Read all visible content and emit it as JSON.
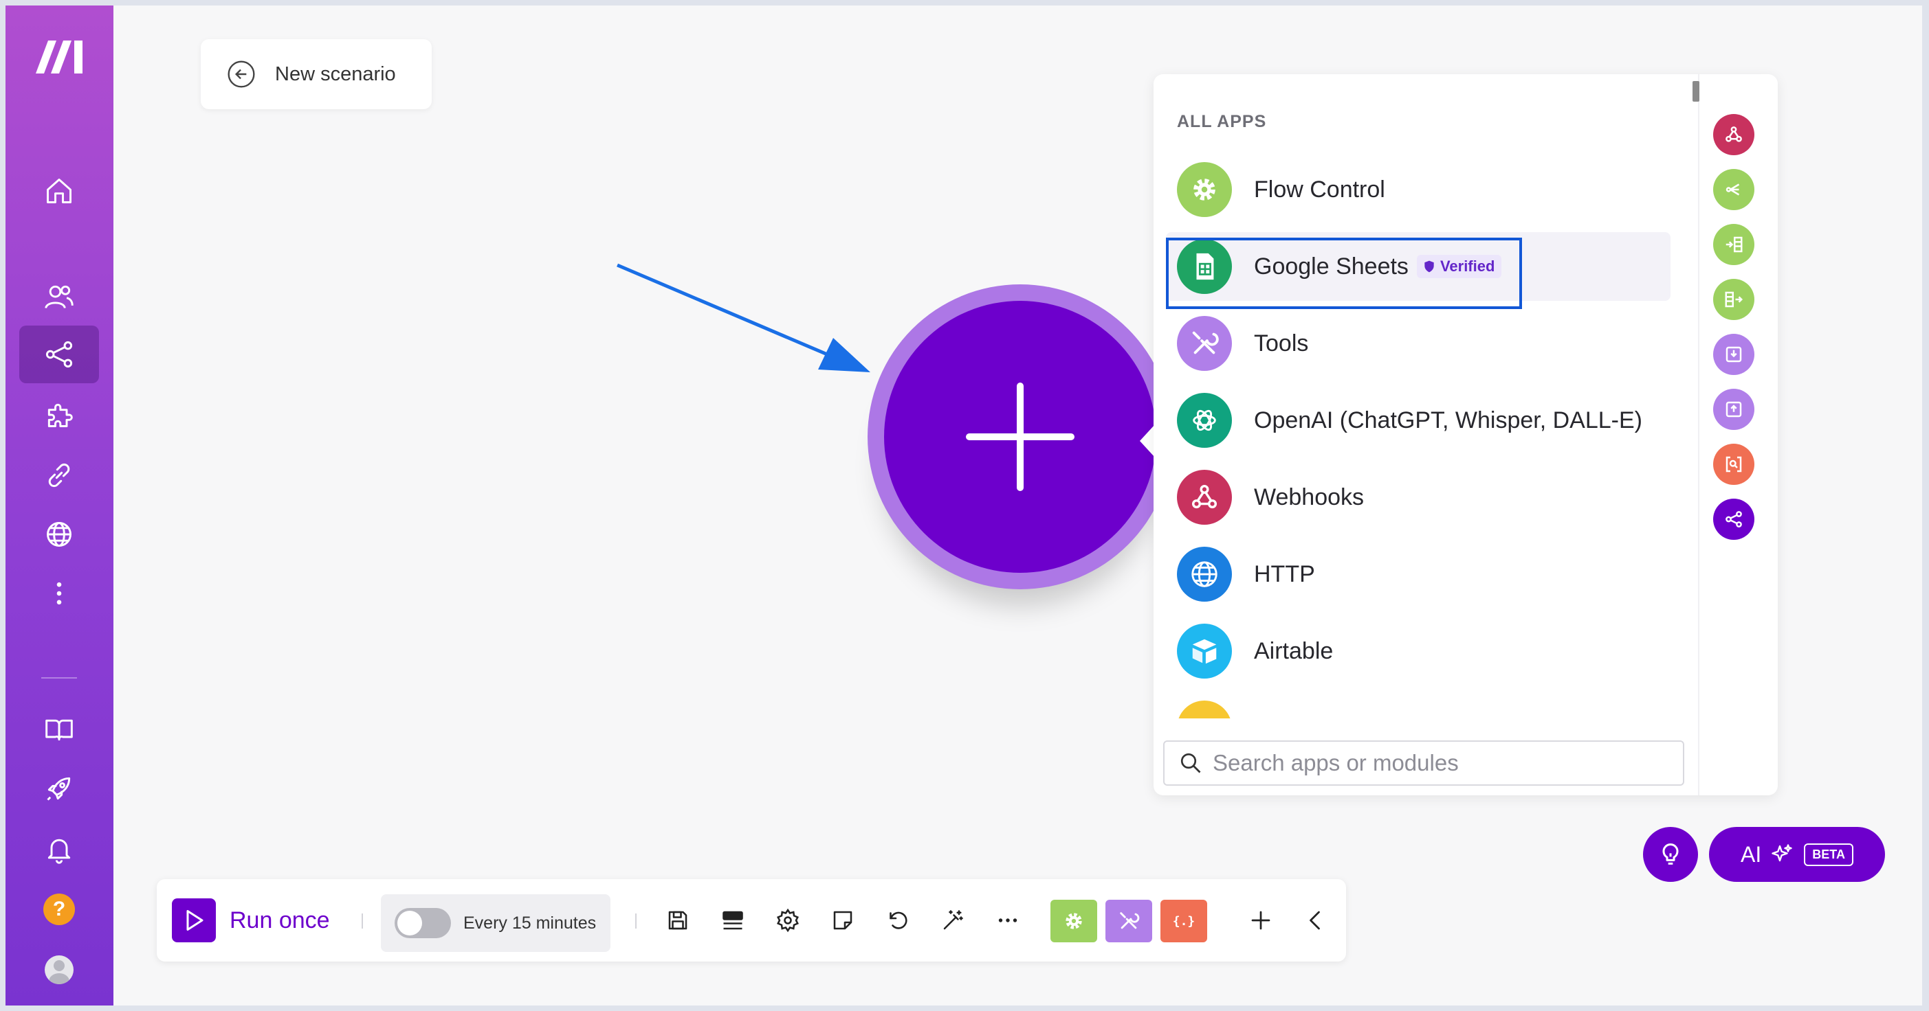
{
  "header": {
    "title": "New scenario"
  },
  "sidebar": {
    "items": [
      {
        "id": "home",
        "icon": "home-icon"
      },
      {
        "id": "team",
        "icon": "users-icon"
      },
      {
        "id": "scenarios",
        "icon": "share-nodes-icon",
        "active": true
      },
      {
        "id": "apps",
        "icon": "puzzle-icon"
      },
      {
        "id": "connections",
        "icon": "link-icon"
      },
      {
        "id": "webhooks",
        "icon": "globe-icon"
      },
      {
        "id": "more",
        "icon": "more-vertical-icon"
      },
      {
        "id": "docs",
        "icon": "book-icon"
      },
      {
        "id": "whats-new",
        "icon": "rocket-icon"
      },
      {
        "id": "notifications",
        "icon": "bell-icon"
      },
      {
        "id": "help",
        "icon": "help-icon",
        "label": "?"
      },
      {
        "id": "profile",
        "icon": "avatar-icon"
      }
    ]
  },
  "picker": {
    "section_label": "ALL APPS",
    "apps": [
      {
        "name": "Flow Control",
        "color": "#9cd15f",
        "icon": "gear-icon"
      },
      {
        "name": "Google Sheets",
        "color": "#1fa463",
        "icon": "sheets-icon",
        "badge": "Verified",
        "selected": true
      },
      {
        "name": "Tools",
        "color": "#b07fe9",
        "icon": "tools-icon"
      },
      {
        "name": "OpenAI (ChatGPT, Whisper, DALL-E)",
        "color": "#10a37f",
        "icon": "openai-icon"
      },
      {
        "name": "Webhooks",
        "color": "#c8325e",
        "icon": "webhook-icon"
      },
      {
        "name": "HTTP",
        "color": "#1b7fe0",
        "icon": "globe-icon"
      },
      {
        "name": "Airtable",
        "color": "#1fb8f0",
        "icon": "airtable-icon"
      },
      {
        "name": "",
        "color": "#f7c731",
        "icon": "drive-icon"
      }
    ],
    "search_placeholder": "Search apps or modules",
    "rail": [
      {
        "icon": "webhook-icon",
        "color": "#c8325e"
      },
      {
        "icon": "router-icon",
        "color": "#9cd15f"
      },
      {
        "icon": "iterator-icon",
        "color": "#9cd15f"
      },
      {
        "icon": "aggregator-icon",
        "color": "#9cd15f"
      },
      {
        "icon": "import-icon",
        "color": "#b07fe9"
      },
      {
        "icon": "export-icon",
        "color": "#b07fe9"
      },
      {
        "icon": "text-parser-icon",
        "color": "#f06f53"
      },
      {
        "icon": "share-nodes-icon",
        "color": "#6d00cc"
      }
    ]
  },
  "toolbar": {
    "run_label": "Run once",
    "schedule_label": "Every 15 minutes",
    "schedule_enabled": false,
    "tile_text_parser": "{.}",
    "colors": {
      "flow": "#9cd15f",
      "tools": "#b07fe9",
      "parser": "#f06f53"
    }
  },
  "floating": {
    "ai_label": "AI",
    "beta_label": "BETA"
  },
  "colors": {
    "brand": "#6d00cc",
    "selection": "#1257d6"
  }
}
